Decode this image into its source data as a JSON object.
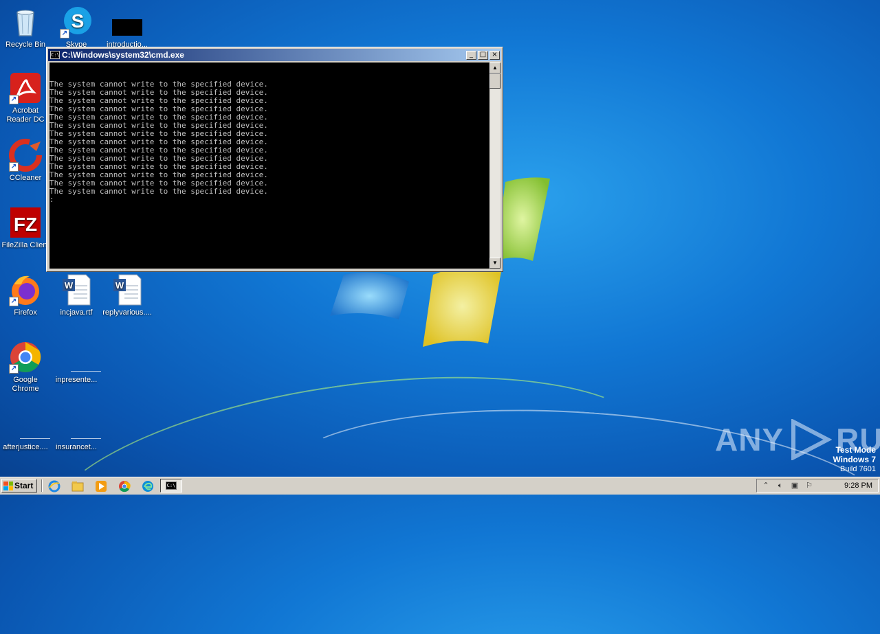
{
  "desktop": {
    "icons": [
      {
        "label": "Recycle Bin",
        "icon": "recycle-bin-icon"
      },
      {
        "label": "Skype",
        "icon": "skype-icon"
      },
      {
        "label": "introductio...",
        "icon": "document-icon"
      },
      {
        "label": "Acrobat Reader DC",
        "icon": "acrobat-icon"
      },
      {
        "label": "CCleaner",
        "icon": "ccleaner-icon"
      },
      {
        "label": "FileZilla Client",
        "icon": "filezilla-icon"
      },
      {
        "label": "Firefox",
        "icon": "firefox-icon"
      },
      {
        "label": "incjava.rtf",
        "icon": "word-doc-icon"
      },
      {
        "label": "replyvarious....",
        "icon": "word-doc-icon"
      },
      {
        "label": "Google Chrome",
        "icon": "chrome-icon"
      },
      {
        "label": "inpresente...",
        "icon": "blank-file-icon"
      },
      {
        "label": "afterjustice....",
        "icon": "blank-file-icon"
      },
      {
        "label": "insurancet...",
        "icon": "blank-file-icon"
      }
    ]
  },
  "cmd_window": {
    "title": "C:\\Windows\\system32\\cmd.exe",
    "icon_text": "C:\\",
    "buttons": {
      "minimize": "_",
      "maximize": "□",
      "close": "×"
    },
    "output": "The system cannot write to the specified device.\nThe system cannot write to the specified device.\nThe system cannot write to the specified device.\nThe system cannot write to the specified device.\nThe system cannot write to the specified device.\nThe system cannot write to the specified device.\nThe system cannot write to the specified device.\nThe system cannot write to the specified device.\nThe system cannot write to the specified device.\nThe system cannot write to the specified device.\nThe system cannot write to the specified device.\nThe system cannot write to the specified device.\nThe system cannot write to the specified device.\nThe system cannot write to the specified device.\n:"
  },
  "watermark": {
    "brand": "ANY.RUN",
    "left_text": "ANY",
    "right_text": "RUN",
    "test_mode": [
      "Test Mode",
      "Windows 7",
      "Build 7601"
    ]
  },
  "taskbar": {
    "start_label": "Start",
    "quick_launch": [
      "ie-icon",
      "explorer-icon",
      "media-player-icon",
      "chrome-icon",
      "edge-icon"
    ],
    "active_task_icon_text": "C:\\",
    "tray_icons": [
      "chevron-up-icon",
      "speaker-icon",
      "network-icon",
      "flag-icon"
    ],
    "clock": "9:28 PM"
  },
  "colors": {
    "titlebar_start": "#0a246a",
    "titlebar_end": "#a6caf0",
    "console_bg": "#000000",
    "console_fg": "#c0c0c0",
    "desktop_blue": "#1177d4"
  }
}
